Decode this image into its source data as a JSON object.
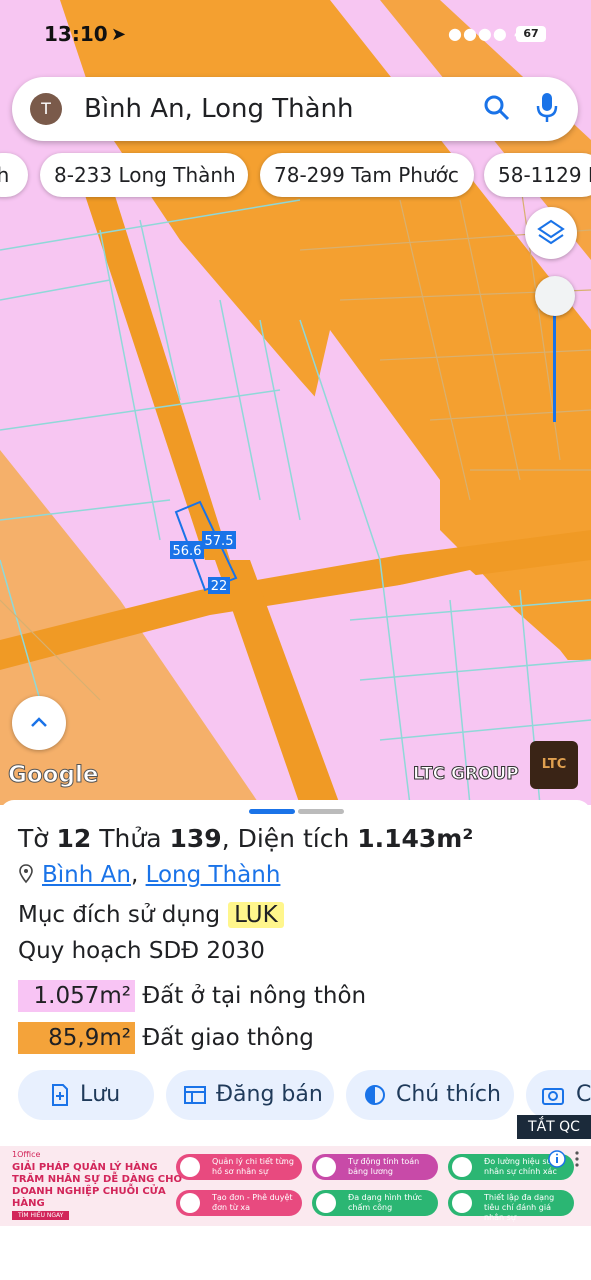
{
  "status_bar": {
    "time": "13:10",
    "signal": "●●●● 4G",
    "battery": "67"
  },
  "search": {
    "avatar_letter": "T",
    "query": "Bình An, Long Thành"
  },
  "chips": [
    "nh",
    "8-233 Long Thành",
    "78-299 Tam Phước",
    "58-1129 L"
  ],
  "map": {
    "parcel_labels": [
      "57.5",
      "56.6",
      "22"
    ],
    "attribution": "Google",
    "watermark": "LTC GROUP",
    "logo_text": "LTC"
  },
  "sheet": {
    "title_prefix": "Tờ ",
    "sheet_no": "12",
    "title_mid": " Thửa ",
    "parcel_no": "139",
    "title_area_label": ", Diện tích ",
    "area": "1.143m²",
    "ward": "Bình An",
    "separator": ", ",
    "district": "Long Thành",
    "usage_label": "Mục đích sử dụng",
    "usage_code": "LUK",
    "plan_label": "Quy hoạch SDĐ 2030",
    "zones": [
      {
        "area": "1.057m²",
        "label": "Đất ở tại nông thôn",
        "color": "#f8c4f4"
      },
      {
        "area": "85,9m²",
        "label": "Đất giao thông",
        "color": "#f4a33a"
      }
    ]
  },
  "actions": {
    "save": "Lưu",
    "sell": "Đăng bán",
    "legend": "Chú thích",
    "photo": "C"
  },
  "ad": {
    "close_tag": "TẮT QC",
    "brand": "1Office",
    "headline": "GIẢI PHÁP QUẢN LÝ HÀNG TRĂM NHÂN SỰ DỄ DÀNG CHO DOANH NGHIỆP CHUỖI CỬA HÀNG",
    "cta": "TÌM HIỂU NGAY",
    "features": [
      "Quản lý chi tiết từng hồ sơ nhân sự",
      "Tự động tính toán bảng lương",
      "Đo lường hiệu suất nhân sự chính xác",
      "Tạo đơn - Phê duyệt đơn từ xa",
      "Đa dạng hình thức chấm công",
      "Thiết lập đa dạng tiêu chí đánh giá nhân sự"
    ]
  }
}
